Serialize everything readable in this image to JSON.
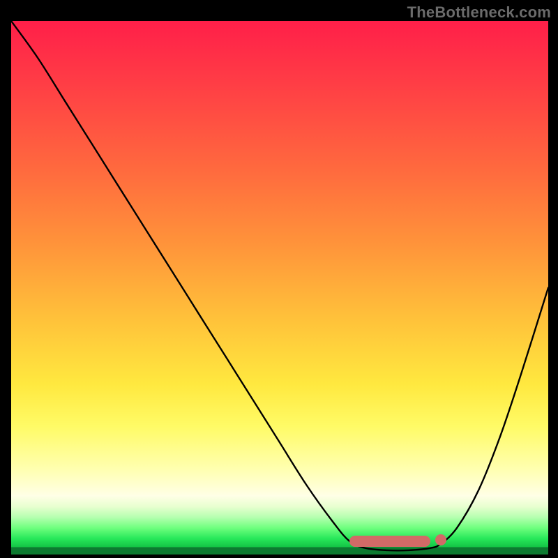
{
  "watermark": "TheBottleneck.com",
  "chart_data": {
    "type": "line",
    "title": "",
    "xlabel": "",
    "ylabel": "",
    "xlim": [
      0,
      100
    ],
    "ylim": [
      0,
      100
    ],
    "curve": [
      {
        "x": 0,
        "y": 100
      },
      {
        "x": 5,
        "y": 93
      },
      {
        "x": 10,
        "y": 85
      },
      {
        "x": 15,
        "y": 77
      },
      {
        "x": 20,
        "y": 69
      },
      {
        "x": 25,
        "y": 61
      },
      {
        "x": 30,
        "y": 53
      },
      {
        "x": 35,
        "y": 45
      },
      {
        "x": 40,
        "y": 37
      },
      {
        "x": 45,
        "y": 29
      },
      {
        "x": 50,
        "y": 21
      },
      {
        "x": 55,
        "y": 13
      },
      {
        "x": 60,
        "y": 6
      },
      {
        "x": 63,
        "y": 2.5
      },
      {
        "x": 66,
        "y": 1.2
      },
      {
        "x": 70,
        "y": 0.8
      },
      {
        "x": 74,
        "y": 0.8
      },
      {
        "x": 78,
        "y": 1.2
      },
      {
        "x": 80,
        "y": 2.0
      },
      {
        "x": 83,
        "y": 5
      },
      {
        "x": 87,
        "y": 12
      },
      {
        "x": 91,
        "y": 22
      },
      {
        "x": 95,
        "y": 34
      },
      {
        "x": 100,
        "y": 50
      }
    ],
    "sweet_spot": {
      "x_start": 63,
      "x_end": 78,
      "dot_x": 80
    },
    "gradient_stops": [
      {
        "pct": 0,
        "color": "#ff1f49"
      },
      {
        "pct": 28,
        "color": "#ff6a3e"
      },
      {
        "pct": 56,
        "color": "#ffc23a"
      },
      {
        "pct": 76,
        "color": "#fffb66"
      },
      {
        "pct": 89,
        "color": "#ffffe6"
      },
      {
        "pct": 95,
        "color": "#6fff7e"
      },
      {
        "pct": 98.6,
        "color": "#14c445"
      }
    ]
  }
}
